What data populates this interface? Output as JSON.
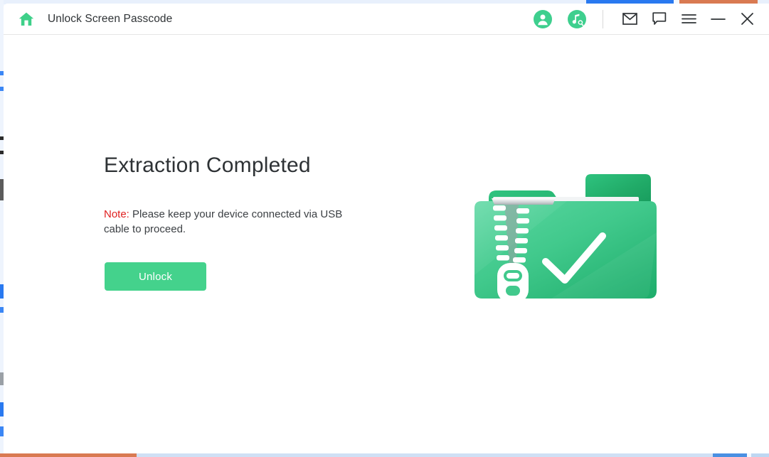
{
  "window": {
    "title": "Unlock Screen Passcode",
    "home_icon": "home-icon"
  },
  "titlebar": {
    "account_icon": "account-icon",
    "music_search_icon": "music-search-icon",
    "mail_icon": "mail-icon",
    "chat_icon": "chat-icon",
    "menu_icon": "hamburger-menu-icon",
    "minimize_icon": "minimize-icon",
    "close_icon": "close-icon"
  },
  "main": {
    "headline": "Extraction Completed",
    "note_label": "Note:",
    "note_text": " Please keep your device connected via USB cable to proceed.",
    "unlock_label": "Unlock",
    "illustration": "zipped-folder-with-check-illustration"
  },
  "colors": {
    "brand_green": "#3ecf8e",
    "button_green": "#44d28c",
    "note_red": "#e02020",
    "title_text": "#2f3336",
    "folder_front": "#4ecb96",
    "folder_back": "#1fa864",
    "desktop_blue": "#2979f0",
    "desktop_orange": "#d97a52",
    "desktop_bg": "#f4f8fe"
  }
}
